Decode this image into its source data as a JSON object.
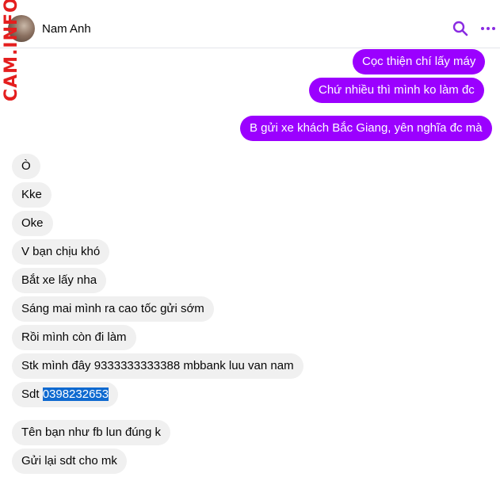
{
  "header": {
    "contact_name": "Nam Anh",
    "watermark": "CAM.INFO"
  },
  "colors": {
    "outgoing_bubble": "#9b00ff",
    "incoming_bubble": "#f0f0f0",
    "accent": "#8a2be2",
    "selection": "#0f6ad0"
  },
  "icons": {
    "search": "search-icon",
    "more": "more-options-icon"
  },
  "messages": {
    "outgoing": [
      "Cọc thiện chí lấy máy",
      "Chứ nhiều thì mình ko làm đc",
      "B gửi xe khách Bắc Giang, yên nghĩa đc mà"
    ],
    "incoming": [
      "Ò",
      "Kke",
      "Oke",
      "V bạn chịu khó",
      "Bắt xe lấy nha",
      "Sáng mai mình ra cao tốc gửi sớm",
      "Rồi mình còn đi làm",
      "Stk mình đây 9333333333388 mbbank luu van nam",
      "Sdt",
      "Tên bạn như fb lun đúng k",
      "Gửi lại sdt cho mk"
    ],
    "phone_selected": "0398232653"
  }
}
